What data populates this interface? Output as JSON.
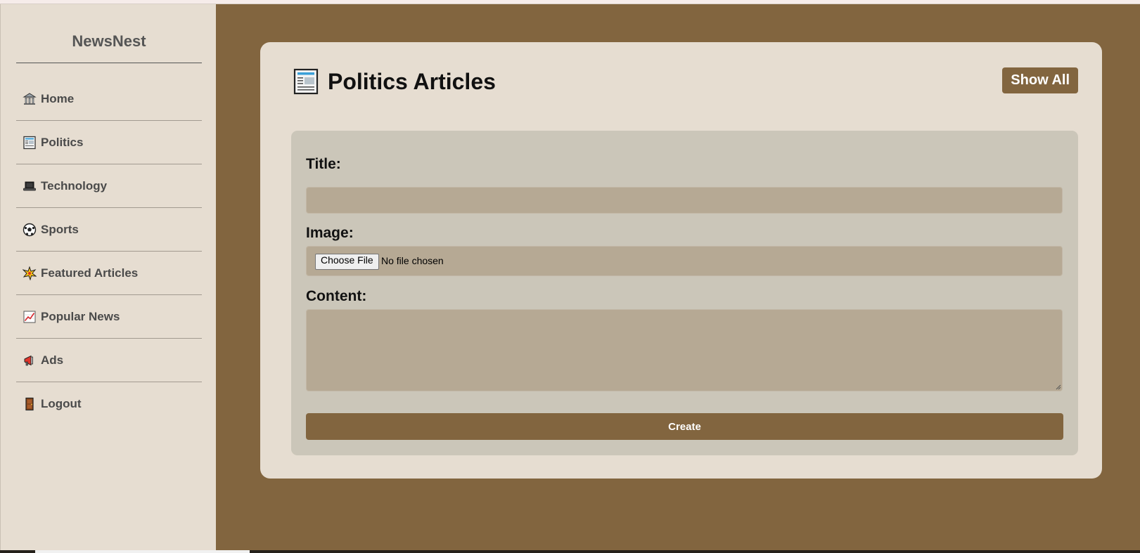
{
  "sidebar": {
    "brand": "NewsNest",
    "items": [
      {
        "label": "Home",
        "icon": "classical-building-icon"
      },
      {
        "label": "Politics",
        "icon": "newspaper-icon"
      },
      {
        "label": "Technology",
        "icon": "laptop-icon"
      },
      {
        "label": "Sports",
        "icon": "soccer-ball-icon"
      },
      {
        "label": "Featured Articles",
        "icon": "sparkle-burst-icon"
      },
      {
        "label": "Popular News",
        "icon": "chart-increasing-icon"
      },
      {
        "label": "Ads",
        "icon": "megaphone-icon"
      },
      {
        "label": "Logout",
        "icon": "door-icon"
      }
    ]
  },
  "main": {
    "title": "Politics Articles",
    "title_icon": "newspaper-icon",
    "show_all_label": "Show All",
    "form": {
      "title_label": "Title:",
      "title_value": "",
      "image_label": "Image:",
      "file_button_label": "Choose File",
      "file_status": "No file chosen",
      "content_label": "Content:",
      "content_value": "",
      "submit_label": "Create"
    }
  },
  "colors": {
    "accent": "#82653f",
    "sidebar_bg": "#e6ddd1",
    "card_bg": "#e6ddd1",
    "form_bg": "#cbc6b9",
    "field_bg": "#b6a994"
  }
}
